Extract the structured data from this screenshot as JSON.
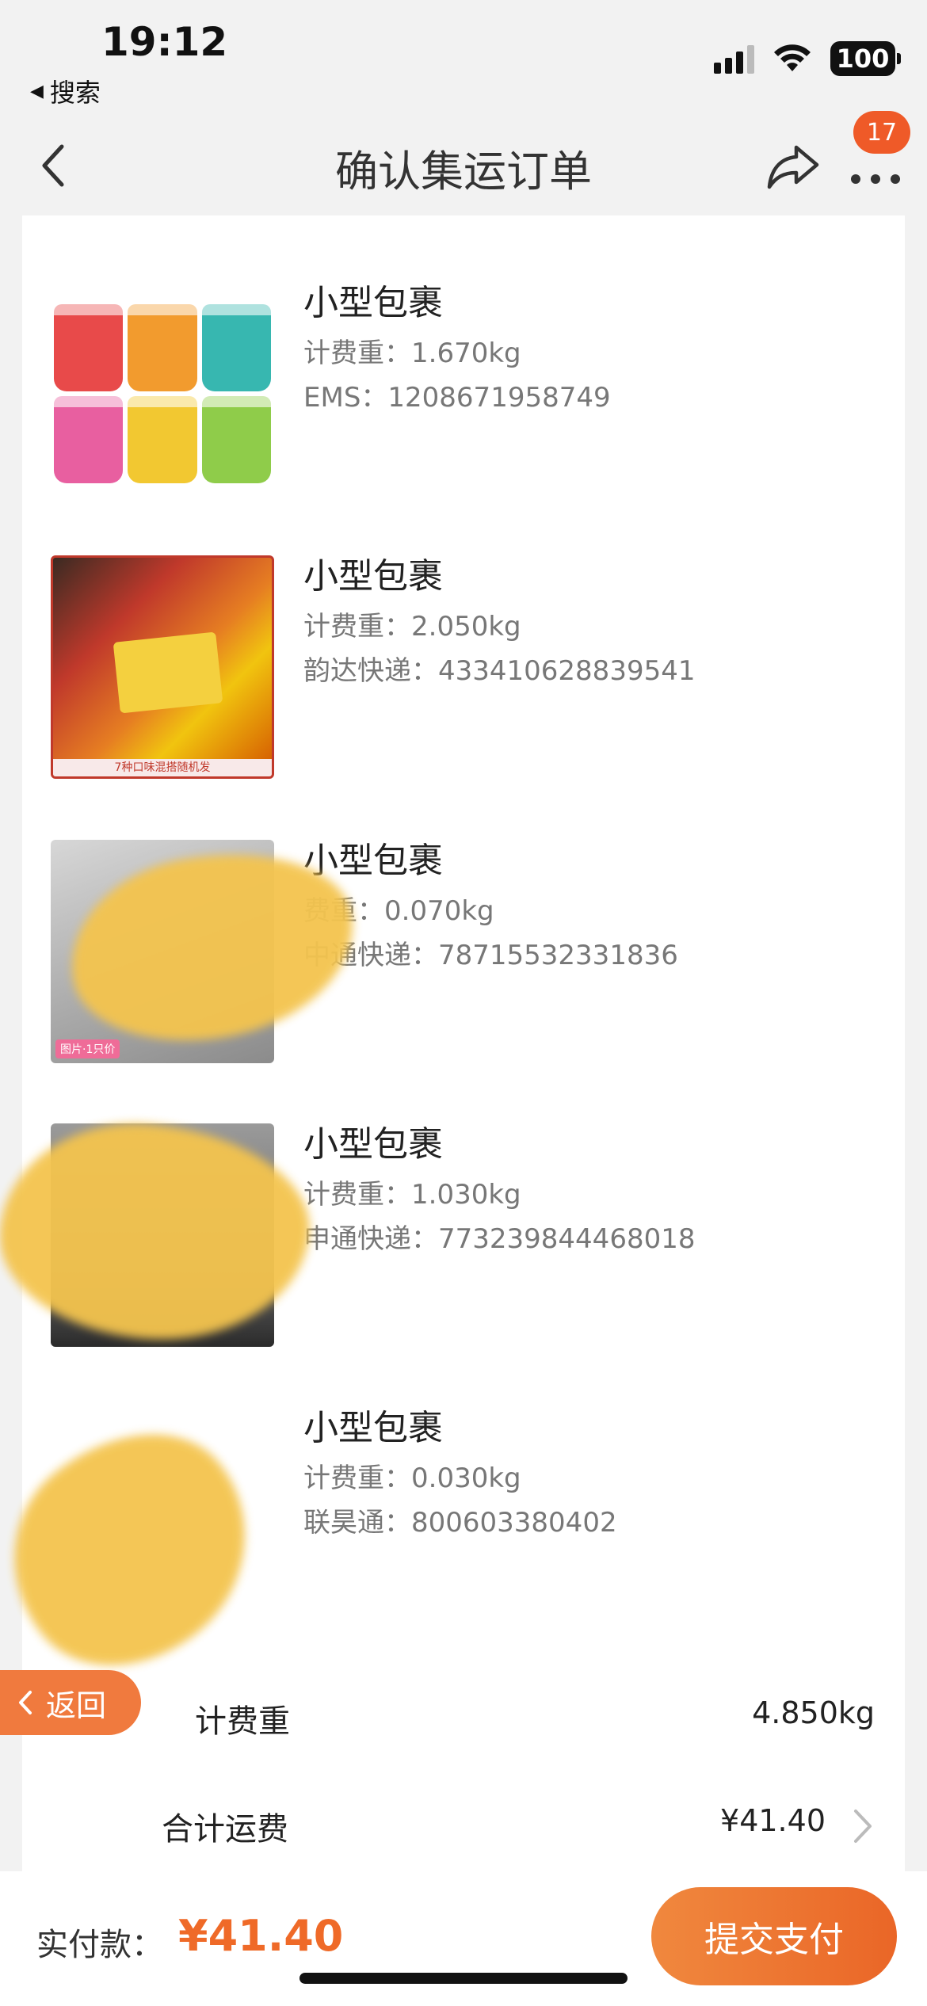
{
  "status_bar": {
    "time": "19:12",
    "back_app_label": "搜索",
    "battery": "100"
  },
  "nav": {
    "title": "确认集运订单",
    "badge_count": "17"
  },
  "packages": [
    {
      "title": "小型包裹",
      "weight": "计费重：1.670kg",
      "tracking": "EMS：1208671958749"
    },
    {
      "title": "小型包裹",
      "weight": "计费重：2.050kg",
      "tracking": "韵达快递：433410628839541"
    },
    {
      "title": "小型包裹",
      "weight": "费重：0.070kg",
      "tracking": "中通快递：78715532331836"
    },
    {
      "title": "小型包裹",
      "weight": "计费重：1.030kg",
      "tracking": "申通快递：773239844468018"
    },
    {
      "title": "小型包裹",
      "weight": "计费重：0.030kg",
      "tracking": "联昊通：800603380402"
    }
  ],
  "thumbnail_snack_caption": "7种口味混搭随机发",
  "thumbnail_gray_caption": "图片·1只价",
  "summary": {
    "weight_label": "计费重",
    "weight_value": "4.850kg",
    "freight_label": "合计运费",
    "freight_value": "¥41.40"
  },
  "float_back_label": "返回",
  "bottom": {
    "pay_label": "实付款：",
    "pay_amount": "¥41.40",
    "submit_label": "提交支付"
  },
  "colors": {
    "accent": "#ef6a28",
    "badge": "#ef5a28",
    "redaction": "#f4c44e"
  }
}
